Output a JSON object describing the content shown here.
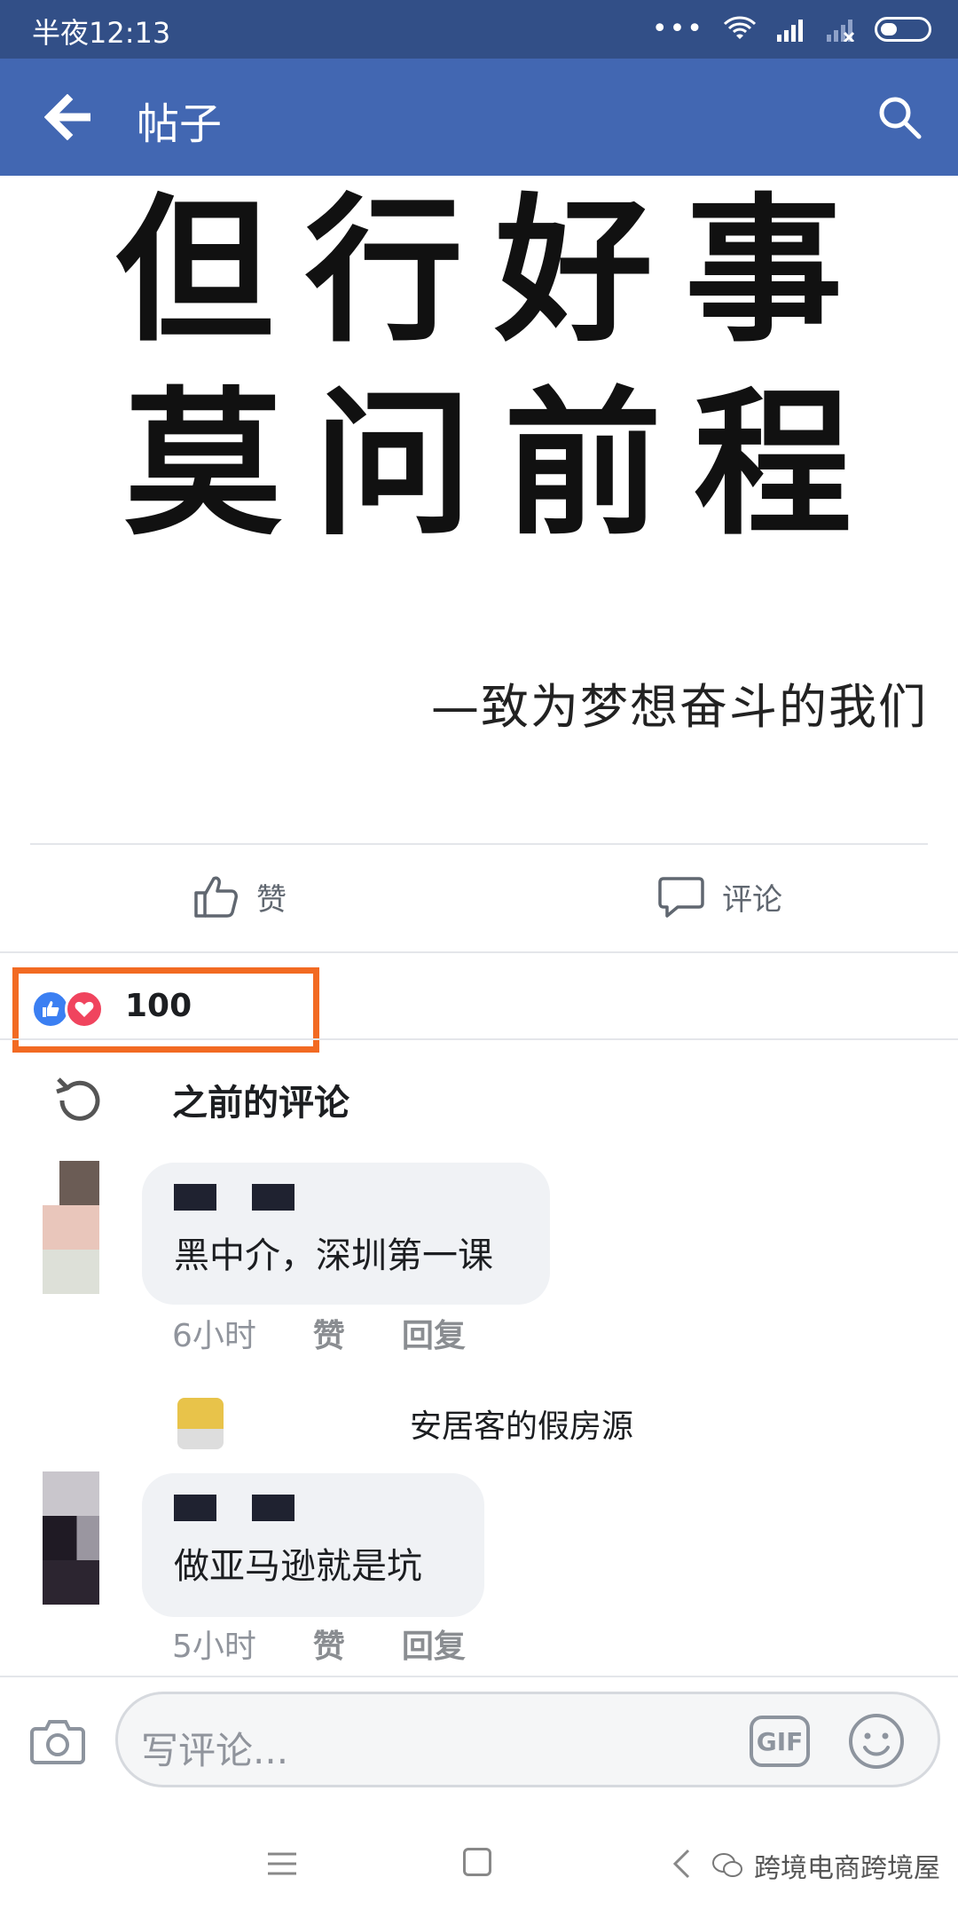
{
  "status_bar": {
    "time": "半夜12:13"
  },
  "app_bar": {
    "title": "帖子"
  },
  "post": {
    "calligraphy_line1": "但行好事",
    "calligraphy_line2": "莫问前程",
    "caption": "—致为梦想奋斗的我们"
  },
  "actions": {
    "like_label": "赞",
    "comment_label": "评论"
  },
  "reactions": {
    "count": "100"
  },
  "comments_section": {
    "previous_label": "之前的评论"
  },
  "comments": [
    {
      "text": "黑中介，深圳第一课",
      "time": "6小时",
      "like": "赞",
      "reply": "回复"
    },
    {
      "text": "做亚马逊就是坑",
      "time": "5小时",
      "like": "赞",
      "reply": "回复"
    }
  ],
  "reply_preview": {
    "text": "安居客的假房源"
  },
  "composer": {
    "placeholder": "写评论...",
    "gif_label": "GIF"
  },
  "watermark": {
    "text": "跨境电商跨境屋"
  },
  "colors": {
    "appbar": "#4267b2",
    "statusbar": "#324f87",
    "highlight": "#f26a22",
    "like_blue": "#3b7ff2",
    "love_red": "#f0445e"
  }
}
